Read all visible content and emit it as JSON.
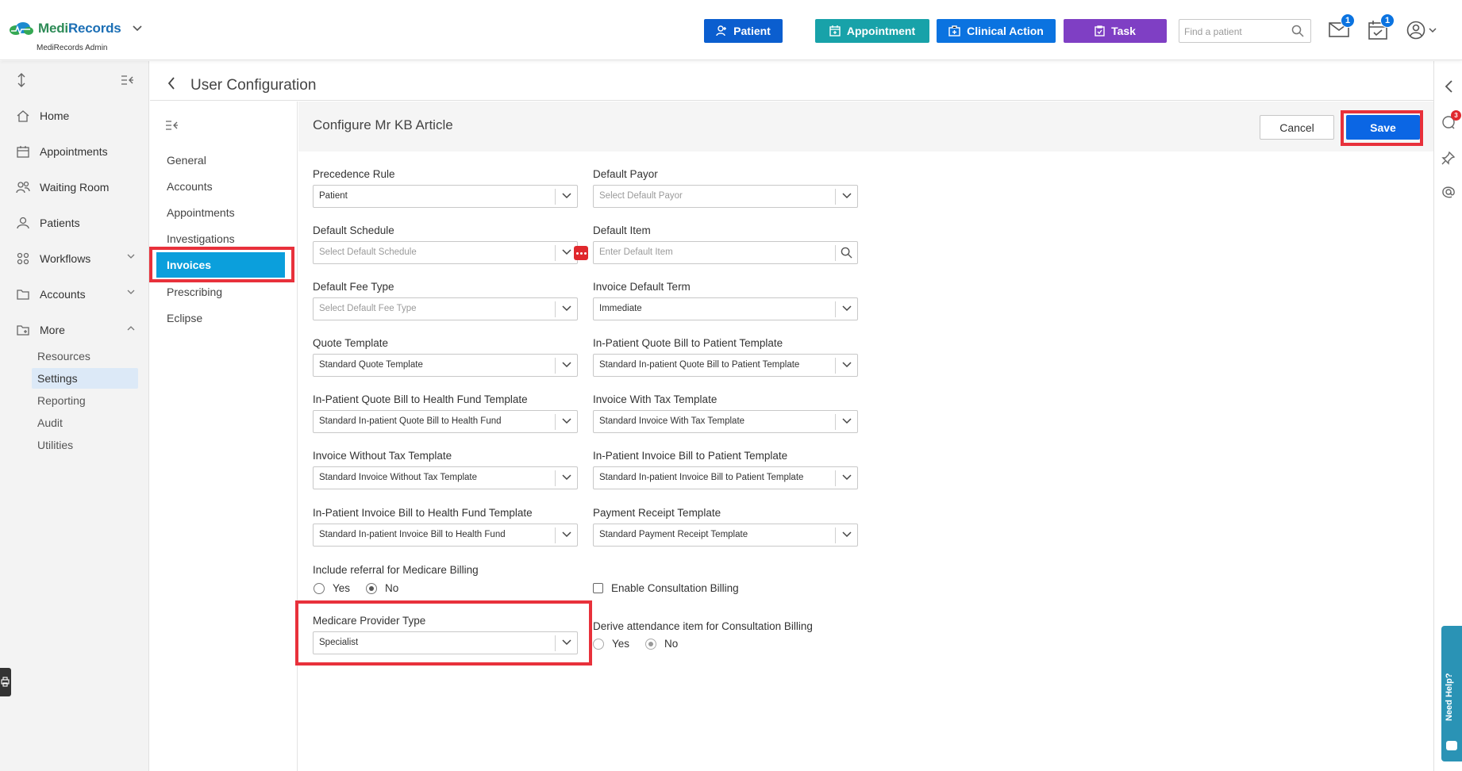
{
  "app": {
    "logo_name": "MediRecords",
    "logo_part1": "Medi",
    "logo_part2": "Records",
    "subtitle": "MediRecords Admin"
  },
  "header": {
    "buttons": {
      "patient": "Patient",
      "appointment": "Appointment",
      "clinical_action": "Clinical Action",
      "task": "Task"
    },
    "search_placeholder": "Find a patient",
    "mail_badge": "1",
    "tasks_badge": "1",
    "colors": {
      "patient": "#0b5ecf",
      "appointment": "#18a2a9",
      "clinical_action": "#0b73e0",
      "task": "#7f3fc4"
    }
  },
  "sidebar": {
    "items": [
      {
        "label": "Home",
        "icon": "home-icon"
      },
      {
        "label": "Appointments",
        "icon": "calendar-icon"
      },
      {
        "label": "Waiting Room",
        "icon": "people-icon"
      },
      {
        "label": "Patients",
        "icon": "patients-icon"
      },
      {
        "label": "Workflows",
        "icon": "workflow-icon"
      },
      {
        "label": "Accounts",
        "icon": "folder-icon"
      },
      {
        "label": "More",
        "icon": "more-folder-icon"
      }
    ],
    "more_sub": [
      "Resources",
      "Settings",
      "Reporting",
      "Audit",
      "Utilities"
    ],
    "active_sub": "Settings"
  },
  "page": {
    "title": "User Configuration"
  },
  "config_nav": {
    "items": [
      "General",
      "Accounts",
      "Appointments",
      "Investigations",
      "Invoices",
      "Prescribing",
      "Eclipse"
    ],
    "active": "Invoices"
  },
  "form": {
    "title": "Configure Mr KB Article",
    "cancel_label": "Cancel",
    "save_label": "Save",
    "fields": {
      "precedence_rule": {
        "label": "Precedence Rule",
        "value": "Patient"
      },
      "default_payor": {
        "label": "Default Payor",
        "placeholder": "Select Default Payor"
      },
      "default_schedule": {
        "label": "Default Schedule",
        "placeholder": "Select Default Schedule"
      },
      "default_item": {
        "label": "Default Item",
        "placeholder": "Enter Default Item"
      },
      "default_fee_type": {
        "label": "Default Fee Type",
        "placeholder": "Select Default Fee Type"
      },
      "invoice_default_term": {
        "label": "Invoice Default Term",
        "value": "Immediate"
      },
      "quote_template": {
        "label": "Quote Template",
        "value": "Standard Quote Template"
      },
      "inpatient_quote_patient": {
        "label": "In-Patient Quote Bill to Patient Template",
        "value": "Standard In-patient Quote Bill to Patient Template"
      },
      "inpatient_quote_fund": {
        "label": "In-Patient Quote Bill to Health Fund Template",
        "value": "Standard In-patient Quote Bill to Health Fund"
      },
      "invoice_with_tax": {
        "label": "Invoice With Tax Template",
        "value": "Standard Invoice With Tax Template"
      },
      "invoice_without_tax": {
        "label": "Invoice Without Tax Template",
        "value": "Standard Invoice Without Tax Template"
      },
      "inpatient_invoice_patient": {
        "label": "In-Patient Invoice Bill to Patient Template",
        "value": "Standard In-patient Invoice Bill to Patient Template"
      },
      "inpatient_invoice_fund": {
        "label": "In-Patient Invoice Bill to Health Fund Template",
        "value": "Standard In-patient Invoice Bill to Health Fund"
      },
      "payment_receipt": {
        "label": "Payment Receipt Template",
        "value": "Standard Payment Receipt Template"
      },
      "include_referral": {
        "label": "Include referral for Medicare Billing",
        "yes": "Yes",
        "no": "No",
        "selected": "No"
      },
      "enable_consultation": {
        "label": "Enable Consultation Billing",
        "checked": false
      },
      "medicare_provider_type": {
        "label": "Medicare Provider Type",
        "value": "Specialist"
      },
      "derive_attendance": {
        "label": "Derive attendance item for Consultation Billing",
        "yes": "Yes",
        "no": "No",
        "selected": "No",
        "disabled": true
      }
    }
  },
  "right_strip": {
    "chat_badge": "3",
    "need_help": "Need Help?"
  }
}
